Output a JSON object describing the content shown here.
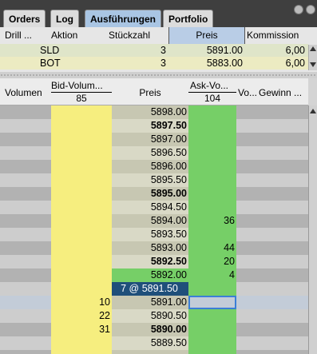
{
  "tabs": [
    {
      "label": "Orders",
      "active": false
    },
    {
      "label": "Log",
      "active": false
    },
    {
      "label": "Ausführungen",
      "active": true
    },
    {
      "label": "Portfolio",
      "active": false
    }
  ],
  "window_icons": [
    "gear-icon",
    "close-icon"
  ],
  "executions": {
    "columns": [
      "Drill ...",
      "Aktion",
      "Stückzahl",
      "Preis",
      "Kommission"
    ],
    "rows": [
      {
        "drill": "",
        "aktion": "SLD",
        "stueckzahl": "3",
        "preis": "5891.00",
        "kommission": "6,00"
      },
      {
        "drill": "",
        "aktion": "BOT",
        "stueckzahl": "3",
        "preis": "5883.00",
        "kommission": "6,00"
      }
    ]
  },
  "book": {
    "headers": {
      "volumen": "Volumen",
      "bid": "Bid-Volum...",
      "bid_total": "85",
      "preis": "Preis",
      "ask": "Ask-Vo...",
      "ask_total": "104",
      "vo": "Vo...",
      "gewinn": "Gewinn ..."
    },
    "rows": [
      {
        "volumen": "",
        "bid": "",
        "preis": "5898.00",
        "ask": "",
        "bold": false,
        "shade": "dark"
      },
      {
        "volumen": "",
        "bid": "",
        "preis": "5897.50",
        "ask": "",
        "bold": true,
        "shade": "light"
      },
      {
        "volumen": "",
        "bid": "",
        "preis": "5897.00",
        "ask": "",
        "bold": false,
        "shade": "dark"
      },
      {
        "volumen": "",
        "bid": "",
        "preis": "5896.50",
        "ask": "",
        "bold": false,
        "shade": "light"
      },
      {
        "volumen": "",
        "bid": "",
        "preis": "5896.00",
        "ask": "",
        "bold": false,
        "shade": "dark"
      },
      {
        "volumen": "",
        "bid": "",
        "preis": "5895.50",
        "ask": "",
        "bold": false,
        "shade": "light"
      },
      {
        "volumen": "",
        "bid": "",
        "preis": "5895.00",
        "ask": "",
        "bold": true,
        "shade": "dark"
      },
      {
        "volumen": "",
        "bid": "",
        "preis": "5894.50",
        "ask": "",
        "bold": false,
        "shade": "light"
      },
      {
        "volumen": "",
        "bid": "",
        "preis": "5894.00",
        "ask": "36",
        "bold": false,
        "shade": "dark"
      },
      {
        "volumen": "",
        "bid": "",
        "preis": "5893.50",
        "ask": "",
        "bold": false,
        "shade": "light"
      },
      {
        "volumen": "",
        "bid": "",
        "preis": "5893.00",
        "ask": "44",
        "bold": false,
        "shade": "dark"
      },
      {
        "volumen": "",
        "bid": "",
        "preis": "5892.50",
        "ask": "20",
        "bold": true,
        "shade": "light"
      },
      {
        "volumen": "",
        "bid": "",
        "preis": "5892.00",
        "ask": "4",
        "bold": false,
        "shade": "dark",
        "price_green": true
      },
      {
        "volumen": "",
        "bid": "",
        "preis": "7 @ 5891.50",
        "ask": "",
        "bold": false,
        "shade": "light",
        "last_trade": true
      },
      {
        "volumen": "",
        "bid": "10",
        "preis": "5891.00",
        "ask": "",
        "bold": false,
        "shade": "dark",
        "selected": true
      },
      {
        "volumen": "",
        "bid": "22",
        "preis": "5890.50",
        "ask": "",
        "bold": false,
        "shade": "light"
      },
      {
        "volumen": "",
        "bid": "31",
        "preis": "5890.00",
        "ask": "",
        "bold": true,
        "shade": "dark"
      },
      {
        "volumen": "",
        "bid": "",
        "preis": "5889.50",
        "ask": "",
        "bold": false,
        "shade": "light"
      },
      {
        "volumen": "",
        "bid": "",
        "preis": "",
        "ask": "",
        "bold": false,
        "shade": "dark"
      }
    ]
  },
  "colors": {
    "bid_column": "#f6ee7f",
    "ask_column": "#76cf67",
    "active_tab": "#a9c5e3",
    "last_trade": "#1f4f7a",
    "selection": "#3b7fd6"
  }
}
